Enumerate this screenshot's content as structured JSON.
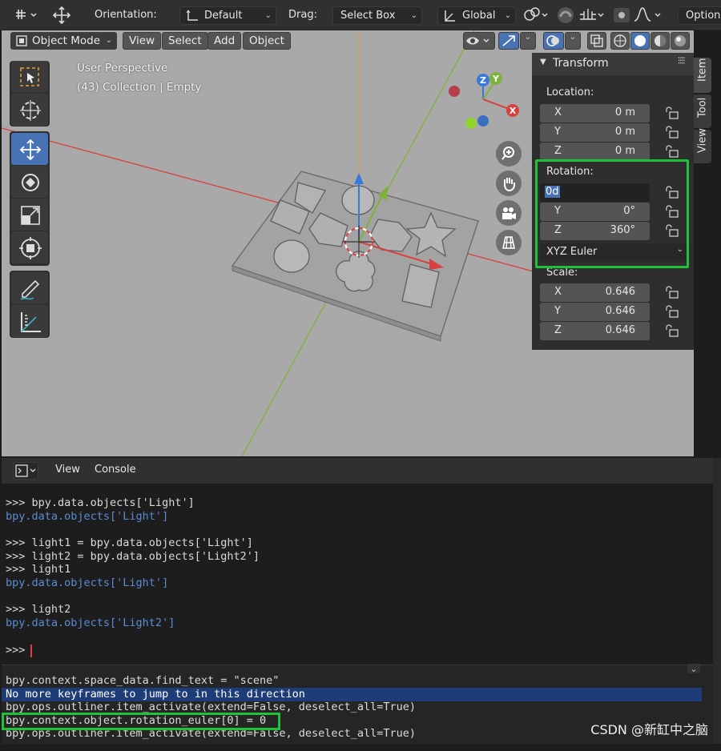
{
  "topbar": {
    "orientation_label": "Orientation:",
    "orientation_value": "Default",
    "drag_label": "Drag:",
    "drag_value": "Select Box",
    "transform_space": "Global",
    "options_label": "Options",
    "icons": [
      "transform-gizmo-icon",
      "move-arrows-icon",
      "axis-icon",
      "link-icon",
      "snap-magnet-icon",
      "snap-grid-icon",
      "proportional-circle-icon",
      "falloff-curve-icon"
    ]
  },
  "viewport_header": {
    "mode": "Object Mode",
    "menus": [
      "View",
      "Select",
      "Add",
      "Object"
    ],
    "icons": [
      "visibility-eye-icon",
      "gizmo-arrows-icon",
      "overlay-icon",
      "xray-icon",
      "wireframe-shading-icon",
      "solid-shading-icon",
      "material-shading-icon",
      "rendered-shading-icon"
    ]
  },
  "viewport": {
    "perspective_text": "User Perspective",
    "collection_text": "(43) Collection | Empty",
    "gizmo_axes": [
      "Z",
      "Y",
      "X"
    ],
    "tools": [
      "select-box-tool",
      "cursor-tool",
      "move-tool",
      "rotate-tool",
      "scale-tool",
      "transform-tool",
      "annotate-tool",
      "measure-tool"
    ],
    "active_tool": "move-tool",
    "nav_icons": [
      "zoom-icon",
      "hand-pan-icon",
      "camera-icon",
      "grid-ortho-icon"
    ]
  },
  "npanel": {
    "title": "Transform",
    "tabs": [
      "Item",
      "Tool",
      "View"
    ],
    "location_label": "Location:",
    "location": [
      {
        "axis": "X",
        "value": "0 m"
      },
      {
        "axis": "Y",
        "value": "0 m"
      },
      {
        "axis": "Z",
        "value": "0 m"
      }
    ],
    "rotation_label": "Rotation:",
    "rotation_edit_text": "0d",
    "rotation": [
      {
        "axis": "Y",
        "value": "0°"
      },
      {
        "axis": "Z",
        "value": "360°"
      }
    ],
    "rotation_mode": "XYZ Euler",
    "scale_label": "Scale:",
    "scale": [
      {
        "axis": "X",
        "value": "0.646"
      },
      {
        "axis": "Y",
        "value": "0.646"
      },
      {
        "axis": "Z",
        "value": "0.646"
      }
    ]
  },
  "console": {
    "menus": [
      "View",
      "Console"
    ],
    "lines": [
      {
        "text": ">>> bpy.data.objects['Light']",
        "kind": "in"
      },
      {
        "text": "bpy.data.objects['Light']",
        "kind": "out"
      },
      {
        "text": "",
        "kind": "in"
      },
      {
        "text": ">>> light1 = bpy.data.objects['Light']",
        "kind": "in"
      },
      {
        "text": ">>> light2 = bpy.data.objects['Light2']",
        "kind": "in"
      },
      {
        "text": ">>> light1",
        "kind": "in"
      },
      {
        "text": "bpy.data.objects['Light']",
        "kind": "out"
      },
      {
        "text": "",
        "kind": "in"
      },
      {
        "text": ">>> light2",
        "kind": "in"
      },
      {
        "text": "bpy.data.objects['Light2']",
        "kind": "out"
      },
      {
        "text": "",
        "kind": "in"
      },
      {
        "text": ">>> ",
        "kind": "in"
      }
    ]
  },
  "info_log": {
    "lines": [
      "bpy.context.space_data.find_text = \"scene\"",
      "No more keyframes to jump to in this direction",
      "bpy.ops.outliner.item_activate(extend=False, deselect_all=True)",
      "bpy.context.object.rotation_euler[0] = 0",
      "bpy.ops.outliner.item_activate(extend=False, deselect_all=True)"
    ]
  },
  "watermark": "CSDN @新缸中之脑",
  "colors": {
    "highlight_green": "#22c13a",
    "active_blue": "#4772b3",
    "axis_red": "#d94040",
    "axis_green": "#7fb23a",
    "console_output": "#5a8cd6"
  }
}
